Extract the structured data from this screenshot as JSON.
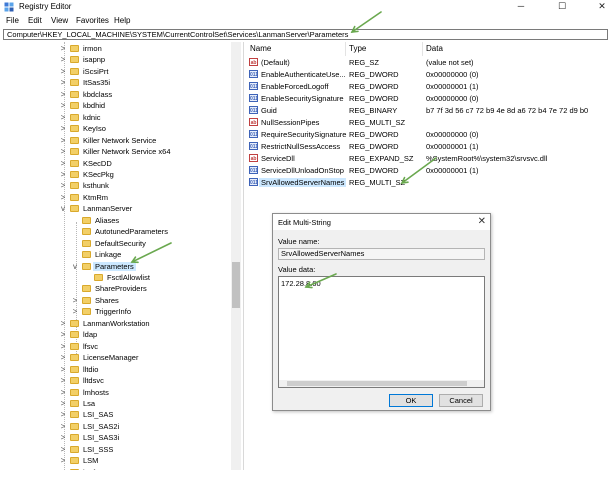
{
  "window": {
    "title": "Registry Editor",
    "minimize_glyph": "─",
    "maximize_glyph": "☐",
    "close_glyph": "✕"
  },
  "menu": [
    "File",
    "Edit",
    "View",
    "Favorites",
    "Help"
  ],
  "address": "Computer\\HKEY_LOCAL_MACHINE\\SYSTEM\\CurrentControlSet\\Services\\LanmanServer\\Parameters",
  "tree": [
    {
      "label": "irmon",
      "level": 0,
      "expander": ">"
    },
    {
      "label": "isapnp",
      "level": 0,
      "expander": ">"
    },
    {
      "label": "iScsiPrt",
      "level": 0,
      "expander": ">"
    },
    {
      "label": "ItSas35i",
      "level": 0,
      "expander": ">"
    },
    {
      "label": "kbdclass",
      "level": 0,
      "expander": ">"
    },
    {
      "label": "kbdhid",
      "level": 0,
      "expander": ">"
    },
    {
      "label": "kdnic",
      "level": 0,
      "expander": ">"
    },
    {
      "label": "KeyIso",
      "level": 0,
      "expander": ">"
    },
    {
      "label": "Killer Network Service",
      "level": 0,
      "expander": ">"
    },
    {
      "label": "Killer Network Service x64",
      "level": 0,
      "expander": ">"
    },
    {
      "label": "KSecDD",
      "level": 0,
      "expander": ">"
    },
    {
      "label": "KSecPkg",
      "level": 0,
      "expander": ">"
    },
    {
      "label": "ksthunk",
      "level": 0,
      "expander": ">"
    },
    {
      "label": "KtmRm",
      "level": 0,
      "expander": ">"
    },
    {
      "label": "LanmanServer",
      "level": 0,
      "expander": "v"
    },
    {
      "label": "Aliases",
      "level": 1,
      "expander": ""
    },
    {
      "label": "AutotunedParameters",
      "level": 1,
      "expander": ""
    },
    {
      "label": "DefaultSecurity",
      "level": 1,
      "expander": ""
    },
    {
      "label": "Linkage",
      "level": 1,
      "expander": ""
    },
    {
      "label": "Parameters",
      "level": 1,
      "expander": "v",
      "selected": true
    },
    {
      "label": "FsctlAllowlist",
      "level": 2,
      "expander": ""
    },
    {
      "label": "ShareProviders",
      "level": 1,
      "expander": ""
    },
    {
      "label": "Shares",
      "level": 1,
      "expander": ">"
    },
    {
      "label": "TriggerInfo",
      "level": 1,
      "expander": ">"
    },
    {
      "label": "LanmanWorkstation",
      "level": 0,
      "expander": ">"
    },
    {
      "label": "ldap",
      "level": 0,
      "expander": ">"
    },
    {
      "label": "lfsvc",
      "level": 0,
      "expander": ">"
    },
    {
      "label": "LicenseManager",
      "level": 0,
      "expander": ">"
    },
    {
      "label": "lltdio",
      "level": 0,
      "expander": ">"
    },
    {
      "label": "lltdsvc",
      "level": 0,
      "expander": ">"
    },
    {
      "label": "lmhosts",
      "level": 0,
      "expander": ">"
    },
    {
      "label": "Lsa",
      "level": 0,
      "expander": ">"
    },
    {
      "label": "LSI_SAS",
      "level": 0,
      "expander": ">"
    },
    {
      "label": "LSI_SAS2i",
      "level": 0,
      "expander": ">"
    },
    {
      "label": "LSI_SAS3i",
      "level": 0,
      "expander": ">"
    },
    {
      "label": "LSI_SSS",
      "level": 0,
      "expander": ">"
    },
    {
      "label": "LSM",
      "level": 0,
      "expander": ">"
    },
    {
      "label": "luafv",
      "level": 0,
      "expander": ">"
    }
  ],
  "columns": {
    "name": "Name",
    "type": "Type",
    "data": "Data"
  },
  "values": [
    {
      "icon": "sz",
      "glyph": "ab",
      "name": "(Default)",
      "type": "REG_SZ",
      "data": "(value not set)"
    },
    {
      "icon": "bin",
      "glyph": "011",
      "name": "EnableAuthenticateUse...",
      "type": "REG_DWORD",
      "data": "0x00000000 (0)"
    },
    {
      "icon": "bin",
      "glyph": "011",
      "name": "EnableForcedLogoff",
      "type": "REG_DWORD",
      "data": "0x00000001 (1)"
    },
    {
      "icon": "bin",
      "glyph": "011",
      "name": "EnableSecuritySignature",
      "type": "REG_DWORD",
      "data": "0x00000000 (0)"
    },
    {
      "icon": "bin",
      "glyph": "011",
      "name": "Guid",
      "type": "REG_BINARY",
      "data": "b7 7f 3d 56 c7 72 b9 4e 8d a6 72 b4 7e 72 d9 b0"
    },
    {
      "icon": "sz",
      "glyph": "ab",
      "name": "NullSessionPipes",
      "type": "REG_MULTI_SZ",
      "data": ""
    },
    {
      "icon": "bin",
      "glyph": "011",
      "name": "RequireSecuritySignature",
      "type": "REG_DWORD",
      "data": "0x00000000 (0)"
    },
    {
      "icon": "bin",
      "glyph": "011",
      "name": "RestrictNullSessAccess",
      "type": "REG_DWORD",
      "data": "0x00000001 (1)"
    },
    {
      "icon": "sz",
      "glyph": "ab",
      "name": "ServiceDll",
      "type": "REG_EXPAND_SZ",
      "data": "%SystemRoot%\\system32\\srvsvc.dll"
    },
    {
      "icon": "bin",
      "glyph": "011",
      "name": "ServiceDllUnloadOnStop",
      "type": "REG_DWORD",
      "data": "0x00000001 (1)"
    },
    {
      "icon": "bin",
      "glyph": "011",
      "name": "SrvAllowedServerNames",
      "type": "REG_MULTI_SZ",
      "data": "",
      "selected": true
    }
  ],
  "dialog": {
    "title": "Edit Multi-String",
    "close_glyph": "✕",
    "value_name_label": "Value name:",
    "value_name": "SrvAllowedServerNames",
    "value_data_label": "Value data:",
    "value_data": "172.28.8.60",
    "ok_label": "OK",
    "cancel_label": "Cancel"
  },
  "colors": {
    "annotation_arrow": "#6aa84f",
    "selection": "#cce8ff",
    "folder": "#f2cf67"
  }
}
